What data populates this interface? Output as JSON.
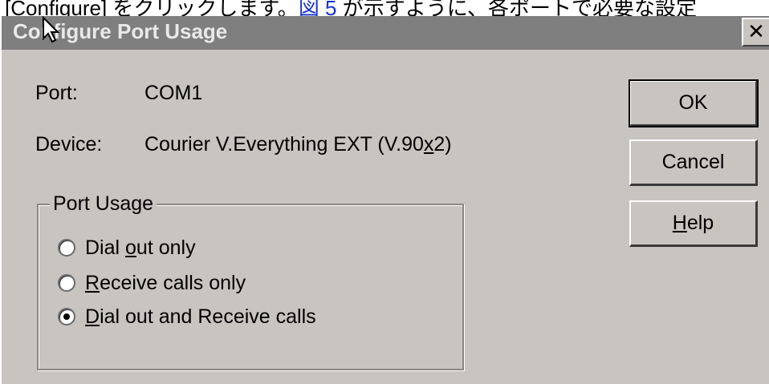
{
  "page": {
    "strip_text_before": "[Configure] をクリックします。",
    "strip_link": "図 5",
    "strip_text_after": " が示すように、各ポートで必要な設定"
  },
  "dialog": {
    "title": "Configure Port Usage",
    "close_glyph": "✕"
  },
  "info": {
    "port_label": "Port:",
    "port_value": "COM1",
    "device_label": "Device:",
    "device_value_prefix": "Courier V.Everything EXT (V.90",
    "device_value_ux": "x",
    "device_value_suffix": "2)"
  },
  "port_usage": {
    "group_title": "Port Usage",
    "options": [
      {
        "pre": "Dial ",
        "u": "o",
        "post": "ut only",
        "selected": false
      },
      {
        "pre": "",
        "u": "R",
        "post": "eceive calls only",
        "selected": false
      },
      {
        "pre": "",
        "u": "D",
        "post": "ial out and Receive calls",
        "selected": true
      }
    ]
  },
  "buttons": {
    "ok": "OK",
    "cancel": "Cancel",
    "help_u": "H",
    "help_rest": "elp"
  },
  "colors": {
    "dialog_bg": "#c8c4c0",
    "titlebar_bg": "#7f7f7f",
    "title_text": "#e9e9e9"
  }
}
